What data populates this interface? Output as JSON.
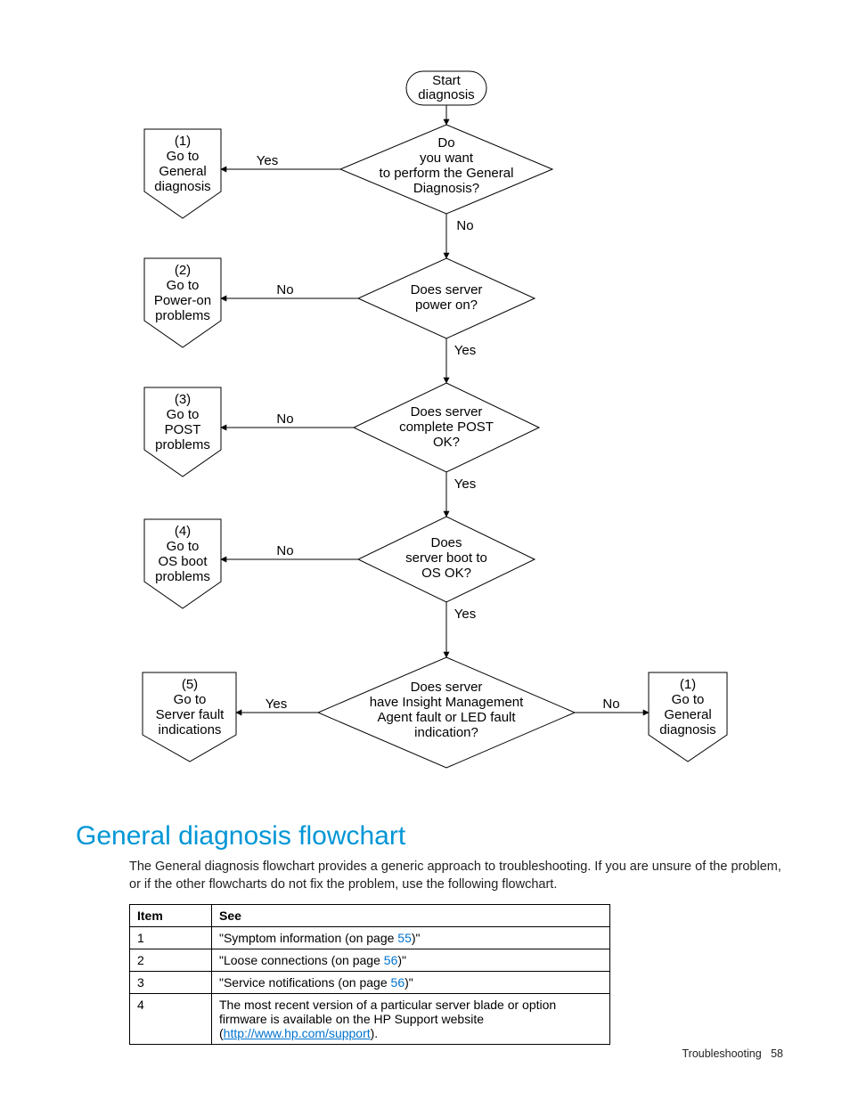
{
  "chart_data": {
    "type": "flowchart",
    "title": "Start diagnosis flowchart",
    "nodes": [
      {
        "id": "start",
        "shape": "terminator",
        "text": "Start diagnosis"
      },
      {
        "id": "d1",
        "shape": "decision",
        "text": "Do you want to perform the General Diagnosis?"
      },
      {
        "id": "d2",
        "shape": "decision",
        "text": "Does server power on?"
      },
      {
        "id": "d3",
        "shape": "decision",
        "text": "Does server complete POST OK?"
      },
      {
        "id": "d4",
        "shape": "decision",
        "text": "Does server boot to OS OK?"
      },
      {
        "id": "d5",
        "shape": "decision",
        "text": "Does server have Insight Management Agent fault or LED fault indication?"
      },
      {
        "id": "o1",
        "shape": "offpage",
        "text": "(1) Go to General diagnosis"
      },
      {
        "id": "o2",
        "shape": "offpage",
        "text": "(2) Go to Power-on problems"
      },
      {
        "id": "o3",
        "shape": "offpage",
        "text": "(3) Go to POST problems"
      },
      {
        "id": "o4",
        "shape": "offpage",
        "text": "(4) Go to OS boot problems"
      },
      {
        "id": "o5",
        "shape": "offpage",
        "text": "(5) Go to Server fault indications"
      },
      {
        "id": "o6",
        "shape": "offpage",
        "text": "(1) Go to General diagnosis"
      }
    ],
    "edges": [
      {
        "from": "start",
        "to": "d1",
        "label": ""
      },
      {
        "from": "d1",
        "to": "o1",
        "label": "Yes"
      },
      {
        "from": "d1",
        "to": "d2",
        "label": "No"
      },
      {
        "from": "d2",
        "to": "o2",
        "label": "No"
      },
      {
        "from": "d2",
        "to": "d3",
        "label": "Yes"
      },
      {
        "from": "d3",
        "to": "o3",
        "label": "No"
      },
      {
        "from": "d3",
        "to": "d4",
        "label": "Yes"
      },
      {
        "from": "d4",
        "to": "o4",
        "label": "No"
      },
      {
        "from": "d4",
        "to": "d5",
        "label": "Yes"
      },
      {
        "from": "d5",
        "to": "o5",
        "label": "Yes"
      },
      {
        "from": "d5",
        "to": "o6",
        "label": "No"
      }
    ]
  },
  "flow": {
    "start_l1": "Start",
    "start_l2": "diagnosis",
    "d1_l1": "Do",
    "d1_l2": "you want",
    "d1_l3": "to perform the General",
    "d1_l4": "Diagnosis?",
    "d2_l1": "Does server",
    "d2_l2": "power on?",
    "d3_l1": "Does server",
    "d3_l2": "complete POST",
    "d3_l3": "OK?",
    "d4_l1": "Does",
    "d4_l2": "server boot to",
    "d4_l3": "OS OK?",
    "d5_l1": "Does server",
    "d5_l2": "have Insight Management",
    "d5_l3": "Agent fault or LED fault",
    "d5_l4": "indication?",
    "o1_l1": "(1)",
    "o1_l2": "Go to",
    "o1_l3": "General",
    "o1_l4": "diagnosis",
    "o2_l1": "(2)",
    "o2_l2": "Go to",
    "o2_l3": "Power-on",
    "o2_l4": "problems",
    "o3_l1": "(3)",
    "o3_l2": "Go to",
    "o3_l3": "POST",
    "o3_l4": "problems",
    "o4_l1": "(4)",
    "o4_l2": "Go to",
    "o4_l3": "OS boot",
    "o4_l4": "problems",
    "o5_l1": "(5)",
    "o5_l2": "Go to",
    "o5_l3": "Server fault",
    "o5_l4": "indications",
    "o6_l1": "(1)",
    "o6_l2": "Go to",
    "o6_l3": "General",
    "o6_l4": "diagnosis",
    "yes": "Yes",
    "no": "No"
  },
  "heading": "General diagnosis flowchart",
  "body": "The General diagnosis flowchart provides a generic approach to troubleshooting. If you are unsure of the problem, or if the other flowcharts do not fix the problem, use the following flowchart.",
  "table": {
    "h1": "Item",
    "h2": "See",
    "r1c1": "1",
    "r1a": "\"Symptom information (on page ",
    "r1p": "55",
    "r1b": ")\"",
    "r2c1": "2",
    "r2a": "\"Loose connections (on page ",
    "r2p": "56",
    "r2b": ")\"",
    "r3c1": "3",
    "r3a": "\"Service notifications (on page ",
    "r3p": "56",
    "r3b": ")\"",
    "r4c1": "4",
    "r4a": "The most recent version of a particular server blade or option firmware is available on the HP Support website (",
    "r4link": "http://www.hp.com/support",
    "r4b": ")."
  },
  "footer": {
    "section": "Troubleshooting",
    "page": "58"
  }
}
